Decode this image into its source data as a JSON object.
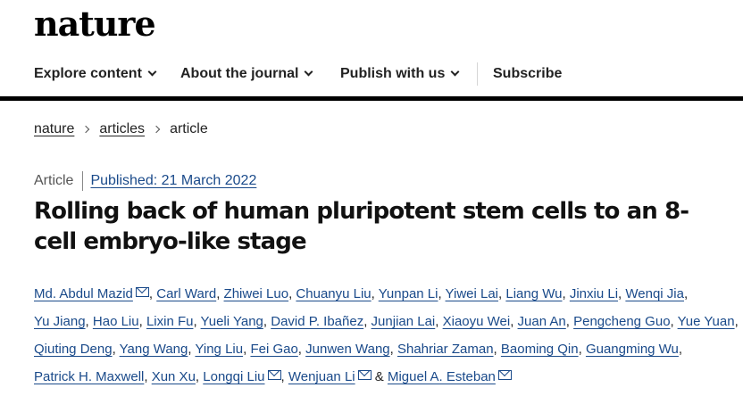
{
  "header": {
    "logo": "nature"
  },
  "nav": {
    "items": [
      {
        "label": "Explore content"
      },
      {
        "label": "About the journal"
      },
      {
        "label": "Publish with us"
      },
      {
        "label": "Subscribe"
      }
    ]
  },
  "breadcrumb": {
    "items": [
      "nature",
      "articles",
      "article"
    ]
  },
  "article": {
    "type": "Article",
    "published": "Published: 21 March 2022",
    "title": "Rolling back of human pluripotent stem cells to an 8-cell embryo-like stage",
    "authors": [
      {
        "name": "Md. Abdul Mazid",
        "email": true
      },
      {
        "name": "Carl Ward"
      },
      {
        "name": "Zhiwei Luo"
      },
      {
        "name": "Chuanyu Liu"
      },
      {
        "name": "Yunpan Li"
      },
      {
        "name": "Yiwei Lai"
      },
      {
        "name": "Liang Wu"
      },
      {
        "name": "Jinxiu Li"
      },
      {
        "name": "Wenqi Jia"
      },
      {
        "name": "Yu Jiang"
      },
      {
        "name": "Hao Liu"
      },
      {
        "name": "Lixin Fu"
      },
      {
        "name": "Yueli Yang"
      },
      {
        "name": "David P. Ibañez"
      },
      {
        "name": "Junjian Lai"
      },
      {
        "name": "Xiaoyu Wei"
      },
      {
        "name": "Juan An"
      },
      {
        "name": "Pengcheng Guo"
      },
      {
        "name": "Yue Yuan"
      },
      {
        "name": "Qiuting Deng"
      },
      {
        "name": "Yang Wang"
      },
      {
        "name": "Ying Liu"
      },
      {
        "name": "Fei Gao"
      },
      {
        "name": "Junwen Wang"
      },
      {
        "name": "Shahriar Zaman"
      },
      {
        "name": "Baoming Qin"
      },
      {
        "name": "Guangming Wu"
      },
      {
        "name": "Patrick H. Maxwell"
      },
      {
        "name": "Xun Xu"
      },
      {
        "name": "Longqi Liu",
        "email": true
      },
      {
        "name": "Wenjuan Li",
        "email": true
      },
      {
        "name": "Miguel A. Esteban",
        "email": true
      }
    ],
    "last_joiner": "&"
  },
  "colors": {
    "link": "#1a4a8a",
    "rule": "#000000"
  }
}
